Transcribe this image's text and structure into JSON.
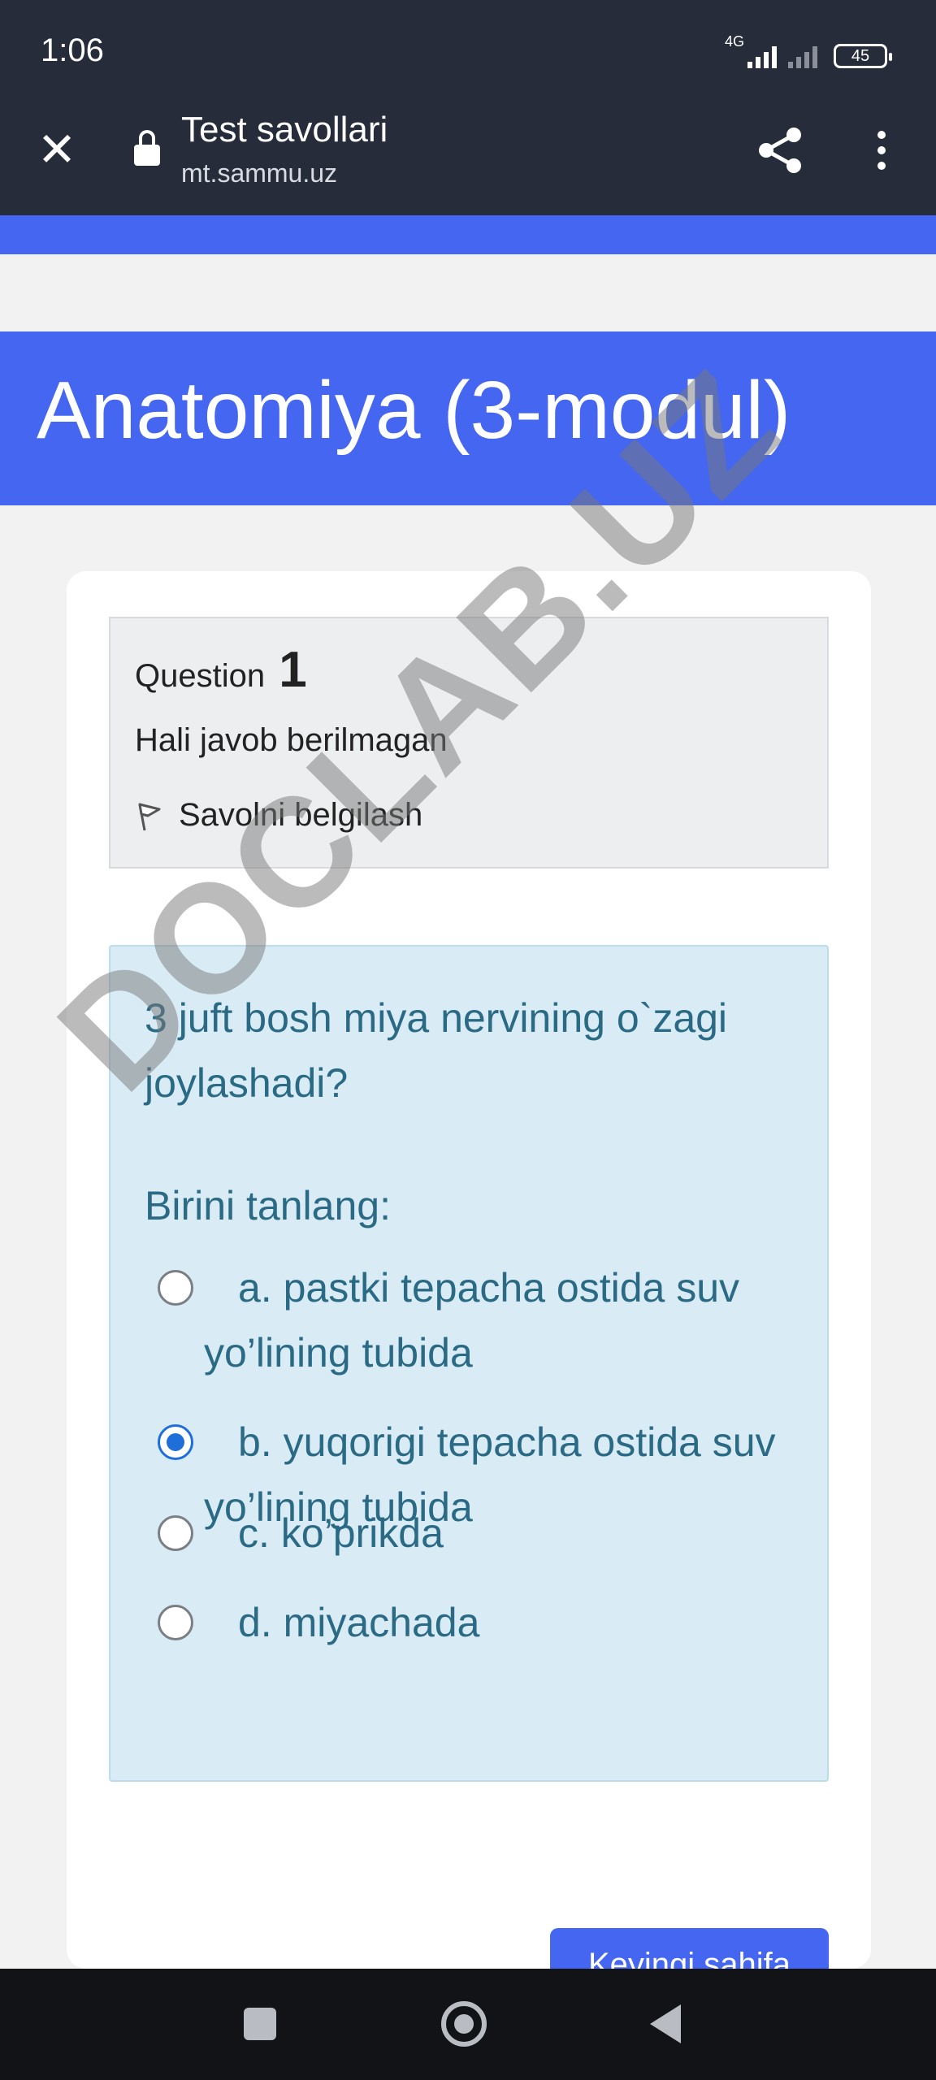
{
  "status_bar": {
    "time": "1:06",
    "network": "4G",
    "battery": "45"
  },
  "browser": {
    "title": "Test savollari",
    "url": "mt.sammu.uz",
    "icons": [
      "close-icon",
      "lock-icon",
      "share-icon",
      "more-vert-icon"
    ]
  },
  "page": {
    "heading": "Anatomiya (3-modul)"
  },
  "question_info": {
    "label": "Question",
    "number": "1",
    "state": "Hali javob berilmagan",
    "flag_label": "Savolni belgilash"
  },
  "question": {
    "text": "3 juft bosh miya nervining o`zagi joylashadi?",
    "choose_label": "Birini tanlang:",
    "answers": [
      {
        "label": "a. pastki tepacha ostida suv yo’lining tubida",
        "selected": false
      },
      {
        "label": "b. yuqorigi tepacha ostida suv yo’lining tubida",
        "selected": true
      },
      {
        "label": "c. ko’prikda",
        "selected": false
      },
      {
        "label": "d. miyachada",
        "selected": false
      }
    ]
  },
  "next_button": {
    "label": "Keyingi sahifa"
  },
  "watermark": "DOCLAB.UZ",
  "colors": {
    "toolbar": "#262c3a",
    "accent": "#4566f0",
    "question_bg": "#d9ecf6",
    "question_text": "#2b6a85"
  }
}
